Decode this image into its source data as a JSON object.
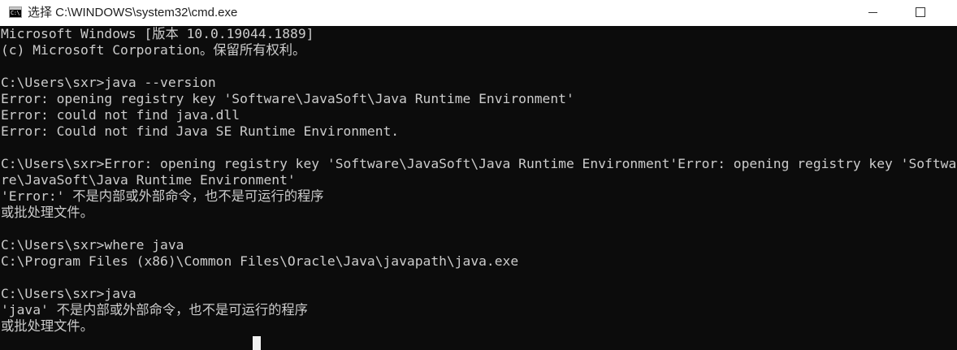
{
  "titlebar": {
    "icon_label": "C:\\.",
    "title": "选择 C:\\WINDOWS\\system32\\cmd.exe"
  },
  "console": {
    "lines": [
      "Microsoft Windows [版本 10.0.19044.1889]",
      "(c) Microsoft Corporation。保留所有权利。",
      "",
      "C:\\Users\\sxr>java --version",
      "Error: opening registry key 'Software\\JavaSoft\\Java Runtime Environment'",
      "Error: could not find java.dll",
      "Error: Could not find Java SE Runtime Environment.",
      "",
      "C:\\Users\\sxr>Error: opening registry key 'Software\\JavaSoft\\Java Runtime Environment'Error: opening registry key 'Softwa",
      "re\\JavaSoft\\Java Runtime Environment'",
      "'Error:' 不是内部或外部命令，也不是可运行的程序",
      "或批处理文件。",
      "",
      "C:\\Users\\sxr>where java",
      "C:\\Program Files (x86)\\Common Files\\Oracle\\Java\\javapath\\java.exe",
      "",
      "C:\\Users\\sxr>java",
      "'java' 不是内部或外部命令，也不是可运行的程序",
      "或批处理文件。"
    ]
  }
}
